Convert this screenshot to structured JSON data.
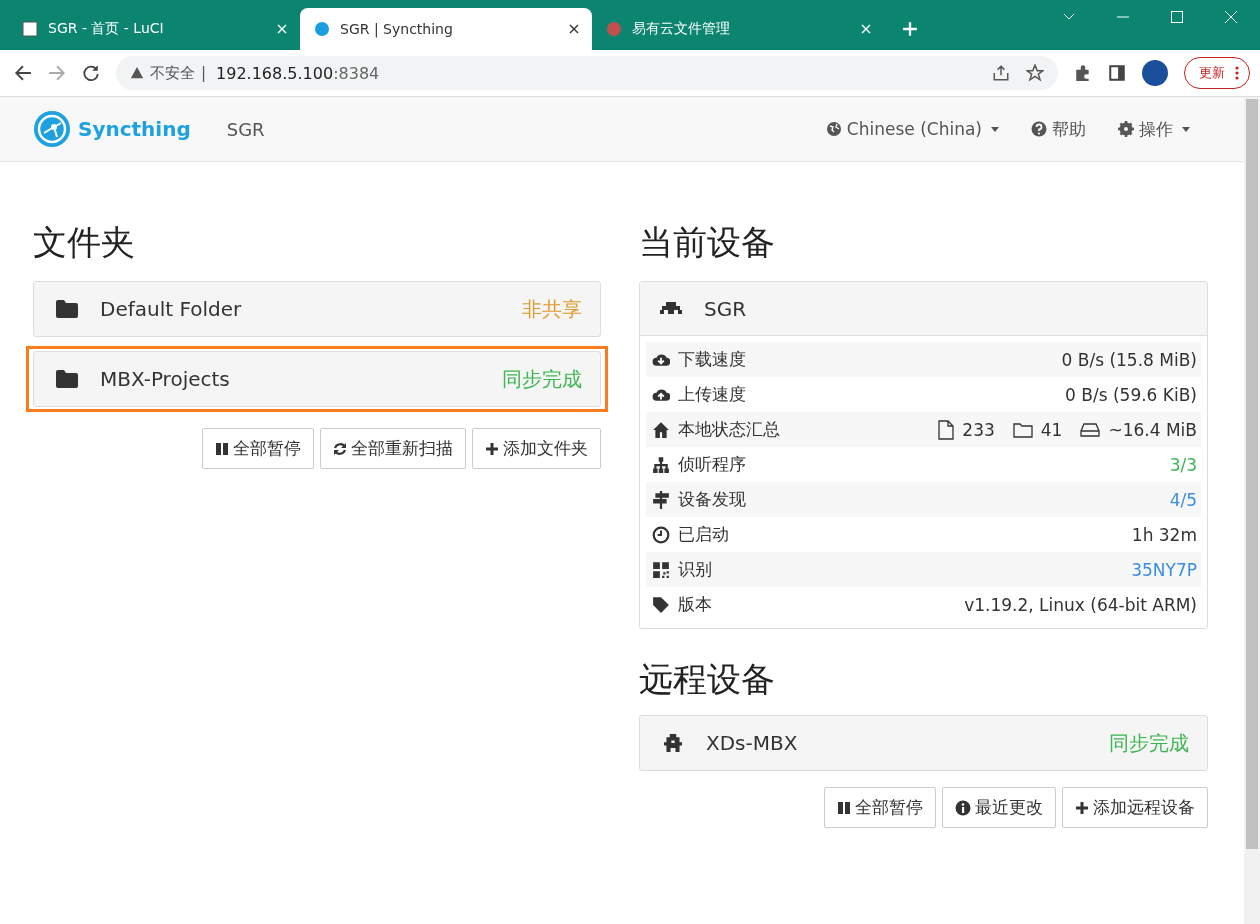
{
  "browser": {
    "tabs": [
      {
        "title": "SGR - 首页 - LuCI",
        "selected": false
      },
      {
        "title": "SGR | Syncthing",
        "selected": true
      },
      {
        "title": "易有云文件管理",
        "selected": false
      }
    ],
    "address": {
      "security": "不安全",
      "separator": "|",
      "host": "192.168.5.100",
      "port": ":8384"
    },
    "update_button": "更新"
  },
  "navbar": {
    "brand": "Syncthing",
    "device": "SGR",
    "language": "Chinese (China)",
    "help": "帮助",
    "actions": "操作"
  },
  "folders": {
    "heading": "文件夹",
    "items": [
      {
        "name": "Default Folder",
        "status": "非共享",
        "color": "#e09a2c",
        "highlighted": false
      },
      {
        "name": "MBX-Projects",
        "status": "同步完成",
        "color": "#3cb650",
        "highlighted": true
      }
    ],
    "buttons": [
      "全部暂停",
      "全部重新扫描",
      "添加文件夹"
    ]
  },
  "this_device": {
    "heading": "当前设备",
    "name": "SGR",
    "rows": [
      {
        "kind": "text",
        "label": "下载速度",
        "value": "0 B/s (15.8 MiB)",
        "color": "#333333"
      },
      {
        "kind": "text",
        "label": "上传速度",
        "value": "0 B/s (59.6 KiB)",
        "color": "#333333"
      },
      {
        "kind": "summary",
        "label": "本地状态汇总",
        "files": "233",
        "folders": "41",
        "size": "~16.4 MiB"
      },
      {
        "kind": "text",
        "label": "侦听程序",
        "value": "3/3",
        "color": "#3cb650"
      },
      {
        "kind": "text",
        "label": "设备发现",
        "value": "4/5",
        "color": "#3a8fdc"
      },
      {
        "kind": "text",
        "label": "已启动",
        "value": "1h 32m",
        "color": "#333333"
      },
      {
        "kind": "text",
        "label": "识别",
        "value": "35NY7P",
        "color": "#3a8fdc"
      },
      {
        "kind": "text",
        "label": "版本",
        "value": "v1.19.2, Linux (64-bit ARM)",
        "color": "#333333"
      }
    ]
  },
  "remote_devices": {
    "heading": "远程设备",
    "items": [
      {
        "name": "XDs-MBX",
        "status": "同步完成",
        "color": "#3cb650"
      }
    ],
    "buttons": [
      "全部暂停",
      "最近更改",
      "添加远程设备"
    ]
  }
}
